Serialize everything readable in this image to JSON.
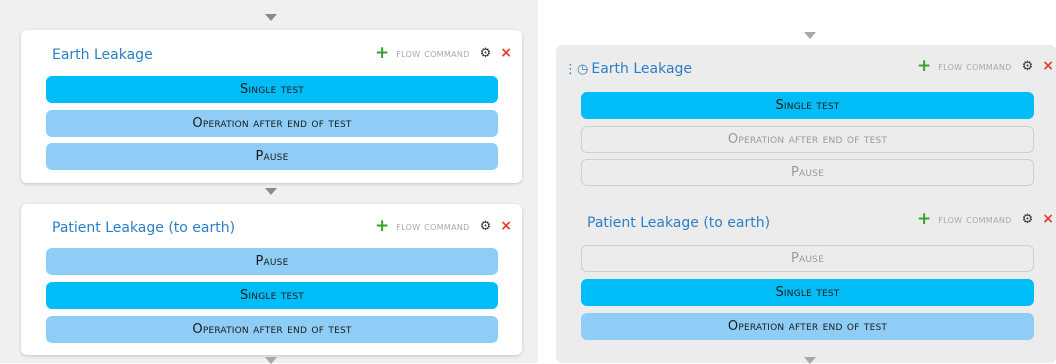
{
  "left_panel": {
    "card1": {
      "title": "Earth Leakage",
      "steps": [
        "Single test",
        "Operation after end of test",
        "Pause"
      ]
    },
    "card2": {
      "title": "Patient Leakage (to earth)",
      "steps": [
        "Pause",
        "Single test",
        "Operation after end of test"
      ]
    }
  },
  "right_panel": {
    "card1": {
      "title": "Earth Leakage",
      "title_icon": "clock-icon",
      "steps": [
        "Single test",
        "Operation after end of test",
        "Pause"
      ]
    },
    "card2": {
      "title": "Patient Leakage (to earth)",
      "steps": [
        "Pause",
        "Single test",
        "Operation after end of test"
      ]
    }
  },
  "actions": {
    "add_icon": "+",
    "flow_command_label": "flow command",
    "settings_icon": "⚙",
    "close_icon": "×"
  },
  "colors": {
    "active_step": "#00bcf7",
    "light_step": "#8fcdf7",
    "title_text": "#2b7fc6",
    "add_green": "#3aa12f",
    "close_red": "#e33a2c"
  }
}
